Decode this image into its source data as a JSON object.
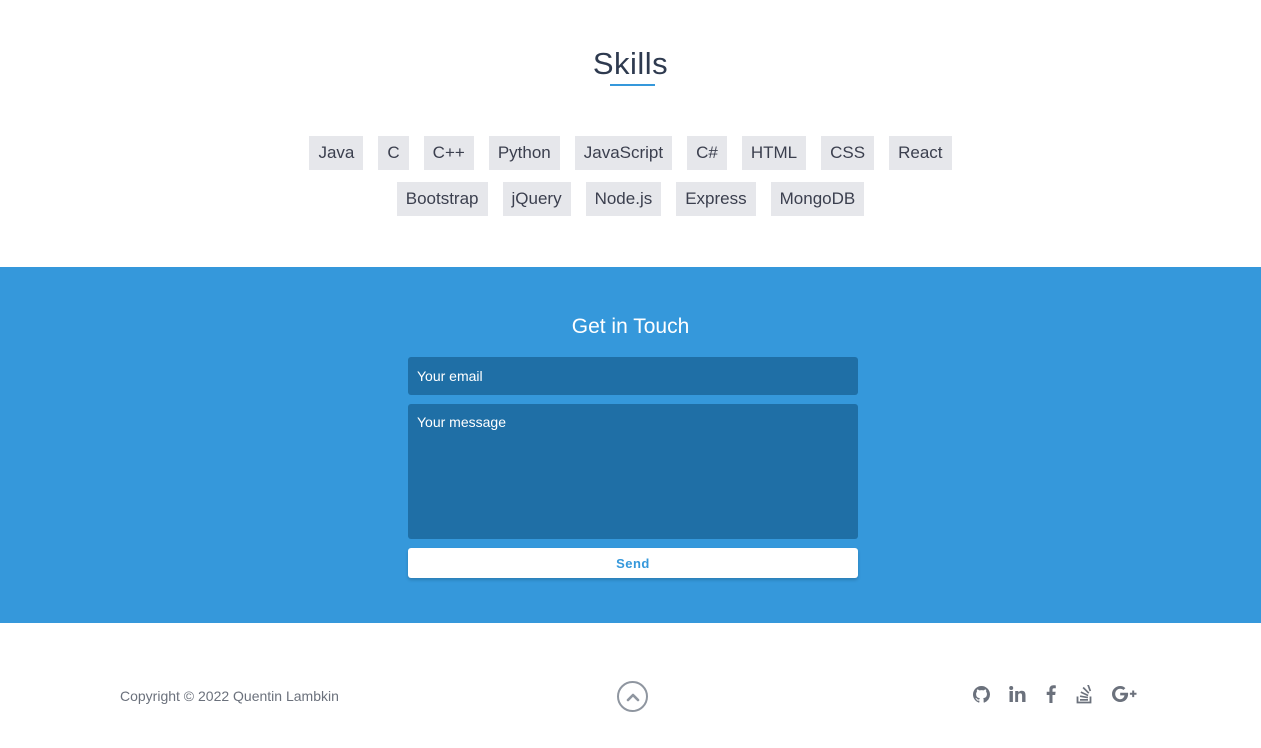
{
  "skills": {
    "title": "Skills",
    "row1": [
      "Java",
      "C",
      "C++",
      "Python",
      "JavaScript",
      "C#",
      "HTML",
      "CSS",
      "React"
    ],
    "row2": [
      "Bootstrap",
      "jQuery",
      "Node.js",
      "Express",
      "MongoDB"
    ]
  },
  "contact": {
    "title": "Get in Touch",
    "email_placeholder": "Your email",
    "email_value": "",
    "message_placeholder": "Your message",
    "message_value": "",
    "send_label": "Send"
  },
  "footer": {
    "copyright": "Copyright © 2022 Quentin Lambkin",
    "scroll_top_icon": "chevron-up-icon",
    "social_icons": [
      "github-icon",
      "linkedin-icon",
      "facebook-icon",
      "stackoverflow-icon",
      "google-plus-icon"
    ]
  },
  "colors": {
    "accent": "#3598db",
    "input_bg": "#1f6fa6",
    "tag_bg": "#e6e7eb",
    "heading_text": "#2e3a4f",
    "footer_text": "#6b717c",
    "icon_gray": "#8f96a0"
  }
}
